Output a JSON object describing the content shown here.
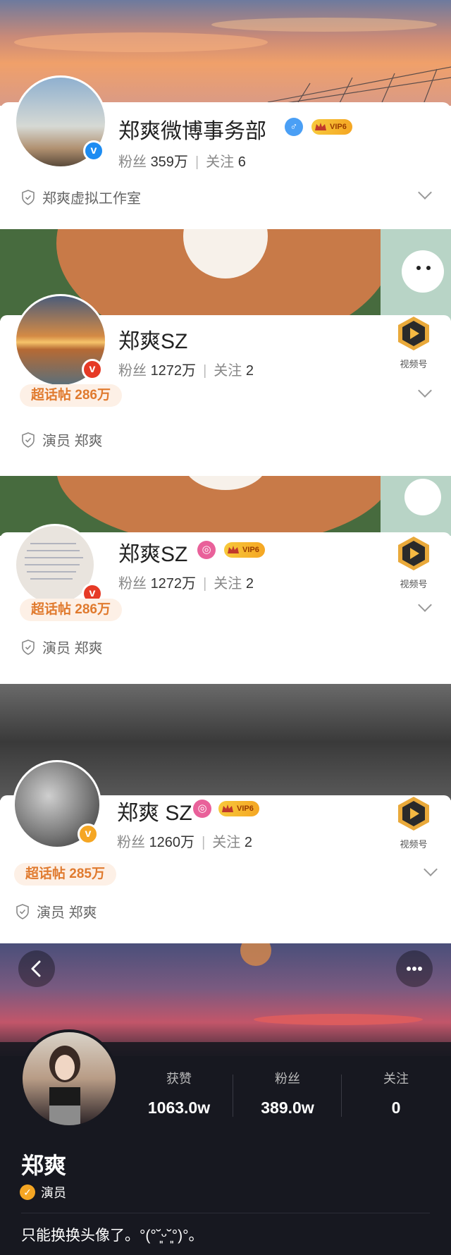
{
  "profiles": [
    {
      "name": "郑爽微博事务部",
      "gender_symbol": "♂",
      "vip_label": "VIP6",
      "fans_label": "粉丝",
      "fans_value": "359万",
      "follow_label": "关注",
      "follow_value": "6",
      "cert_text": "郑爽虚拟工作室",
      "badge_color": "#1d8cf2"
    },
    {
      "name": "郑爽SZ",
      "fans_label": "粉丝",
      "fans_value": "1272万",
      "follow_label": "关注",
      "follow_value": "2",
      "super_topic": "超话帖 286万",
      "cert_text": "演员 郑爽",
      "video_label": "视频号",
      "badge_color": "#e63a26"
    },
    {
      "name": "郑爽SZ",
      "vip_label": "VIP6",
      "fans_label": "粉丝",
      "fans_value": "1272万",
      "follow_label": "关注",
      "follow_value": "2",
      "super_topic": "超话帖 286万",
      "cert_text": "演员 郑爽",
      "video_label": "视频号",
      "badge_color": "#e63a26"
    },
    {
      "name": "郑爽 SZ",
      "vip_label": "VIP6",
      "fans_label": "粉丝",
      "fans_value": "1260万",
      "follow_label": "关注",
      "follow_value": "2",
      "super_topic": "超话帖 285万",
      "cert_text": "演员 郑爽",
      "video_label": "视频号",
      "badge_color": "#f5a623"
    }
  ],
  "douyin": {
    "stats": [
      {
        "label": "获赞",
        "value": "1063.0w"
      },
      {
        "label": "粉丝",
        "value": "389.0w"
      },
      {
        "label": "关注",
        "value": "0"
      }
    ],
    "name": "郑爽",
    "role": "演员",
    "bio": "只能换换头像了。°(°˘͈ᵕ˘͈°)°。"
  },
  "colors": {
    "accent_orange": "#e07a2e",
    "dark_bg": "#171820",
    "verified_blue": "#1d8cf2",
    "verified_red": "#e63a26",
    "verified_gold": "#f5a623"
  }
}
